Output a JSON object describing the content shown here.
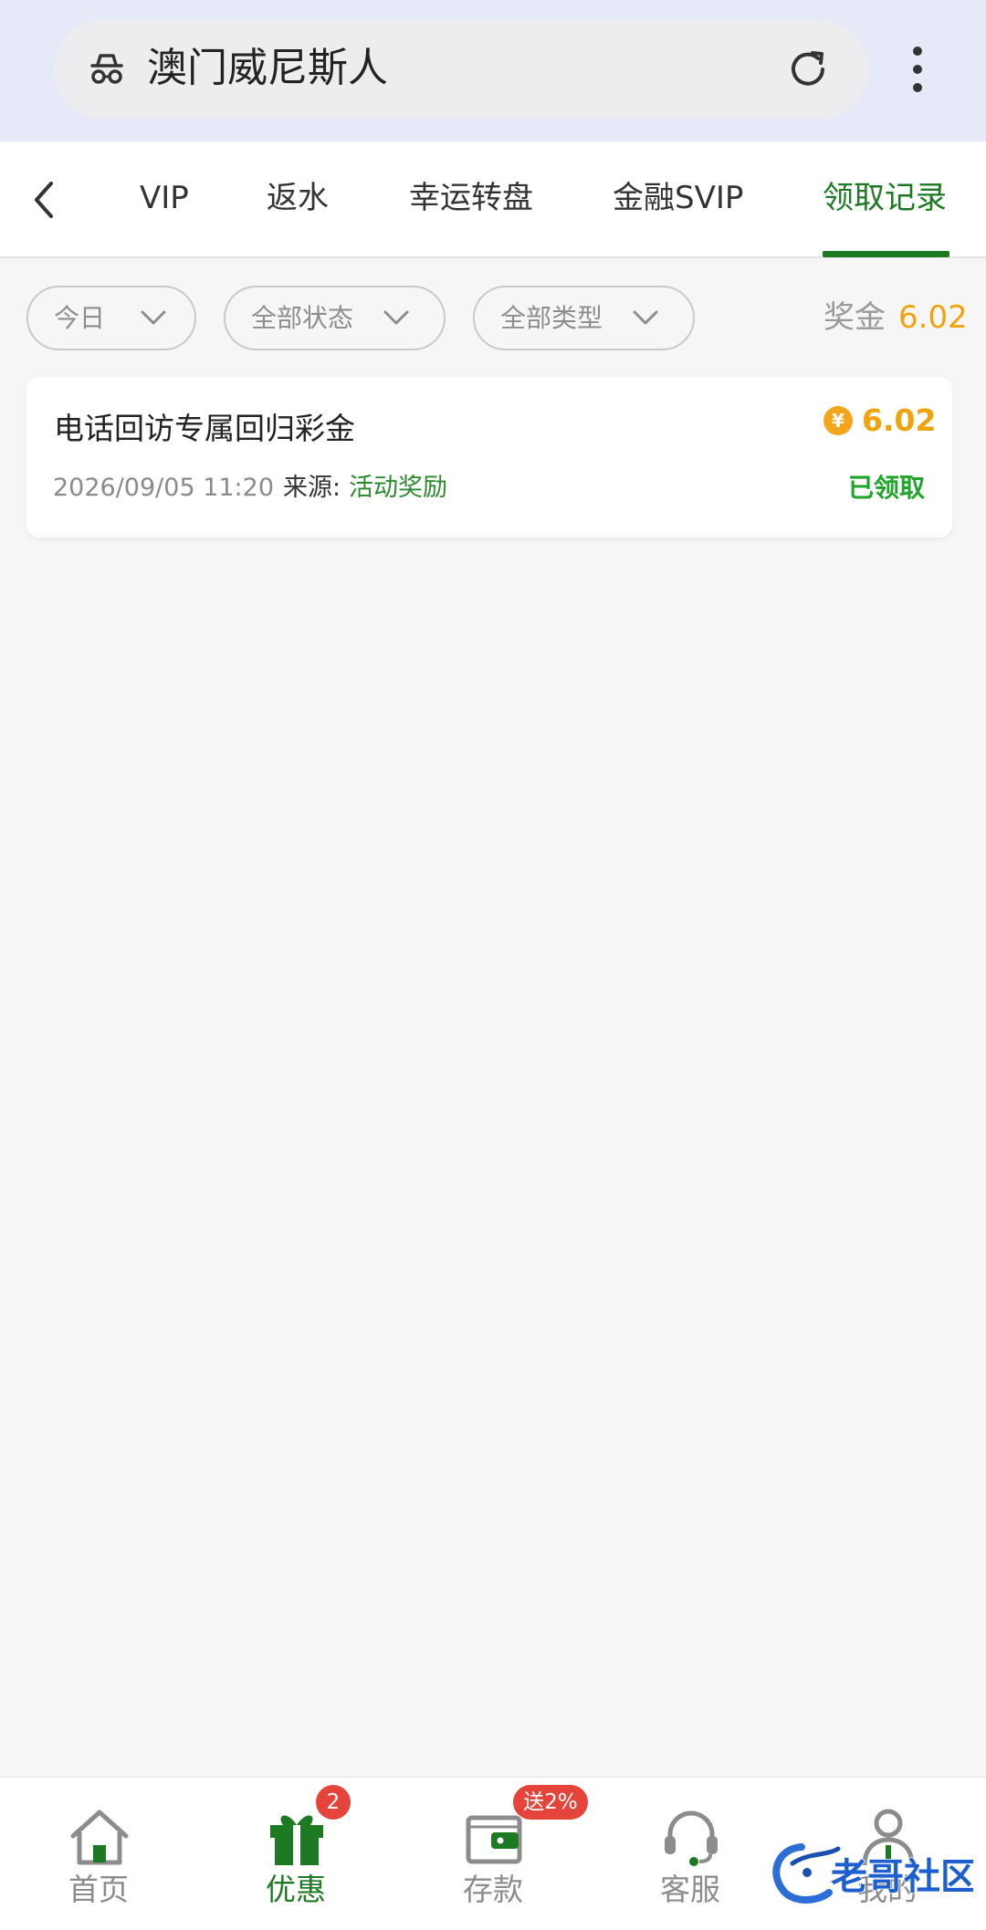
{
  "browser": {
    "title": "澳门威尼斯人",
    "icons": {
      "left": "incognito-icon",
      "reload": "reload-icon",
      "menu": "more-vert-icon"
    }
  },
  "tabs": {
    "back_icon": "chevron-left-icon",
    "items": [
      {
        "label": "VIP"
      },
      {
        "label": "返水"
      },
      {
        "label": "幸运转盘"
      },
      {
        "label": "金融SVIP"
      },
      {
        "label": "领取记录"
      }
    ],
    "active_index": 4
  },
  "filters": {
    "date": "今日",
    "status": "全部状态",
    "type": "全部类型",
    "bonus_label": "奖金",
    "bonus_value": "6.02"
  },
  "records": [
    {
      "title": "电话回访专属回归彩金",
      "amount": "6.02",
      "coin_symbol": "¥",
      "datetime": "2026/09/05 11:20",
      "source_label": "来源:",
      "source_value": "活动奖励",
      "status": "已领取"
    }
  ],
  "bottom_nav": {
    "items": [
      {
        "label": "首页",
        "icon": "home-icon"
      },
      {
        "label": "优惠",
        "icon": "gift-icon",
        "badge": "2"
      },
      {
        "label": "存款",
        "icon": "wallet-icon",
        "badge": "送2%"
      },
      {
        "label": "客服",
        "icon": "headset-icon"
      },
      {
        "label": "我的",
        "icon": "user-icon"
      }
    ],
    "active_index": 1
  },
  "watermark": {
    "text": "老哥社区"
  },
  "colors": {
    "accent_green": "#1e7a22",
    "amount_orange": "#f0a30a",
    "badge_red": "#e5443a",
    "status_green": "#1fa52a"
  }
}
